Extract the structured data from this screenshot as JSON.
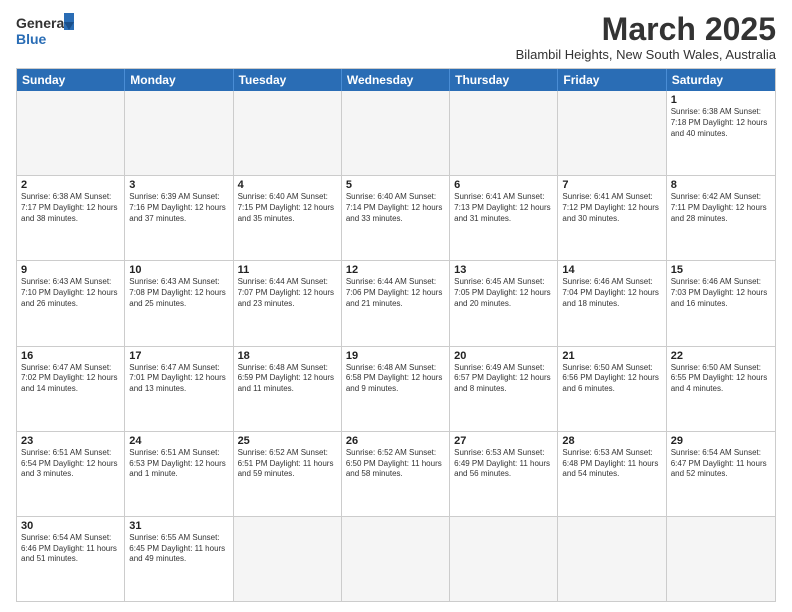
{
  "logo": {
    "text_general": "General",
    "text_blue": "Blue"
  },
  "title": "March 2025",
  "subtitle": "Bilambil Heights, New South Wales, Australia",
  "weekdays": [
    "Sunday",
    "Monday",
    "Tuesday",
    "Wednesday",
    "Thursday",
    "Friday",
    "Saturday"
  ],
  "weeks": [
    [
      {
        "day": "",
        "info": ""
      },
      {
        "day": "",
        "info": ""
      },
      {
        "day": "",
        "info": ""
      },
      {
        "day": "",
        "info": ""
      },
      {
        "day": "",
        "info": ""
      },
      {
        "day": "",
        "info": ""
      },
      {
        "day": "1",
        "info": "Sunrise: 6:38 AM\nSunset: 7:18 PM\nDaylight: 12 hours\nand 40 minutes."
      }
    ],
    [
      {
        "day": "2",
        "info": "Sunrise: 6:38 AM\nSunset: 7:17 PM\nDaylight: 12 hours\nand 38 minutes."
      },
      {
        "day": "3",
        "info": "Sunrise: 6:39 AM\nSunset: 7:16 PM\nDaylight: 12 hours\nand 37 minutes."
      },
      {
        "day": "4",
        "info": "Sunrise: 6:40 AM\nSunset: 7:15 PM\nDaylight: 12 hours\nand 35 minutes."
      },
      {
        "day": "5",
        "info": "Sunrise: 6:40 AM\nSunset: 7:14 PM\nDaylight: 12 hours\nand 33 minutes."
      },
      {
        "day": "6",
        "info": "Sunrise: 6:41 AM\nSunset: 7:13 PM\nDaylight: 12 hours\nand 31 minutes."
      },
      {
        "day": "7",
        "info": "Sunrise: 6:41 AM\nSunset: 7:12 PM\nDaylight: 12 hours\nand 30 minutes."
      },
      {
        "day": "8",
        "info": "Sunrise: 6:42 AM\nSunset: 7:11 PM\nDaylight: 12 hours\nand 28 minutes."
      }
    ],
    [
      {
        "day": "9",
        "info": "Sunrise: 6:43 AM\nSunset: 7:10 PM\nDaylight: 12 hours\nand 26 minutes."
      },
      {
        "day": "10",
        "info": "Sunrise: 6:43 AM\nSunset: 7:08 PM\nDaylight: 12 hours\nand 25 minutes."
      },
      {
        "day": "11",
        "info": "Sunrise: 6:44 AM\nSunset: 7:07 PM\nDaylight: 12 hours\nand 23 minutes."
      },
      {
        "day": "12",
        "info": "Sunrise: 6:44 AM\nSunset: 7:06 PM\nDaylight: 12 hours\nand 21 minutes."
      },
      {
        "day": "13",
        "info": "Sunrise: 6:45 AM\nSunset: 7:05 PM\nDaylight: 12 hours\nand 20 minutes."
      },
      {
        "day": "14",
        "info": "Sunrise: 6:46 AM\nSunset: 7:04 PM\nDaylight: 12 hours\nand 18 minutes."
      },
      {
        "day": "15",
        "info": "Sunrise: 6:46 AM\nSunset: 7:03 PM\nDaylight: 12 hours\nand 16 minutes."
      }
    ],
    [
      {
        "day": "16",
        "info": "Sunrise: 6:47 AM\nSunset: 7:02 PM\nDaylight: 12 hours\nand 14 minutes."
      },
      {
        "day": "17",
        "info": "Sunrise: 6:47 AM\nSunset: 7:01 PM\nDaylight: 12 hours\nand 13 minutes."
      },
      {
        "day": "18",
        "info": "Sunrise: 6:48 AM\nSunset: 6:59 PM\nDaylight: 12 hours\nand 11 minutes."
      },
      {
        "day": "19",
        "info": "Sunrise: 6:48 AM\nSunset: 6:58 PM\nDaylight: 12 hours\nand 9 minutes."
      },
      {
        "day": "20",
        "info": "Sunrise: 6:49 AM\nSunset: 6:57 PM\nDaylight: 12 hours\nand 8 minutes."
      },
      {
        "day": "21",
        "info": "Sunrise: 6:50 AM\nSunset: 6:56 PM\nDaylight: 12 hours\nand 6 minutes."
      },
      {
        "day": "22",
        "info": "Sunrise: 6:50 AM\nSunset: 6:55 PM\nDaylight: 12 hours\nand 4 minutes."
      }
    ],
    [
      {
        "day": "23",
        "info": "Sunrise: 6:51 AM\nSunset: 6:54 PM\nDaylight: 12 hours\nand 3 minutes."
      },
      {
        "day": "24",
        "info": "Sunrise: 6:51 AM\nSunset: 6:53 PM\nDaylight: 12 hours\nand 1 minute."
      },
      {
        "day": "25",
        "info": "Sunrise: 6:52 AM\nSunset: 6:51 PM\nDaylight: 11 hours\nand 59 minutes."
      },
      {
        "day": "26",
        "info": "Sunrise: 6:52 AM\nSunset: 6:50 PM\nDaylight: 11 hours\nand 58 minutes."
      },
      {
        "day": "27",
        "info": "Sunrise: 6:53 AM\nSunset: 6:49 PM\nDaylight: 11 hours\nand 56 minutes."
      },
      {
        "day": "28",
        "info": "Sunrise: 6:53 AM\nSunset: 6:48 PM\nDaylight: 11 hours\nand 54 minutes."
      },
      {
        "day": "29",
        "info": "Sunrise: 6:54 AM\nSunset: 6:47 PM\nDaylight: 11 hours\nand 52 minutes."
      }
    ],
    [
      {
        "day": "30",
        "info": "Sunrise: 6:54 AM\nSunset: 6:46 PM\nDaylight: 11 hours\nand 51 minutes."
      },
      {
        "day": "31",
        "info": "Sunrise: 6:55 AM\nSunset: 6:45 PM\nDaylight: 11 hours\nand 49 minutes."
      },
      {
        "day": "",
        "info": ""
      },
      {
        "day": "",
        "info": ""
      },
      {
        "day": "",
        "info": ""
      },
      {
        "day": "",
        "info": ""
      },
      {
        "day": "",
        "info": ""
      }
    ]
  ]
}
